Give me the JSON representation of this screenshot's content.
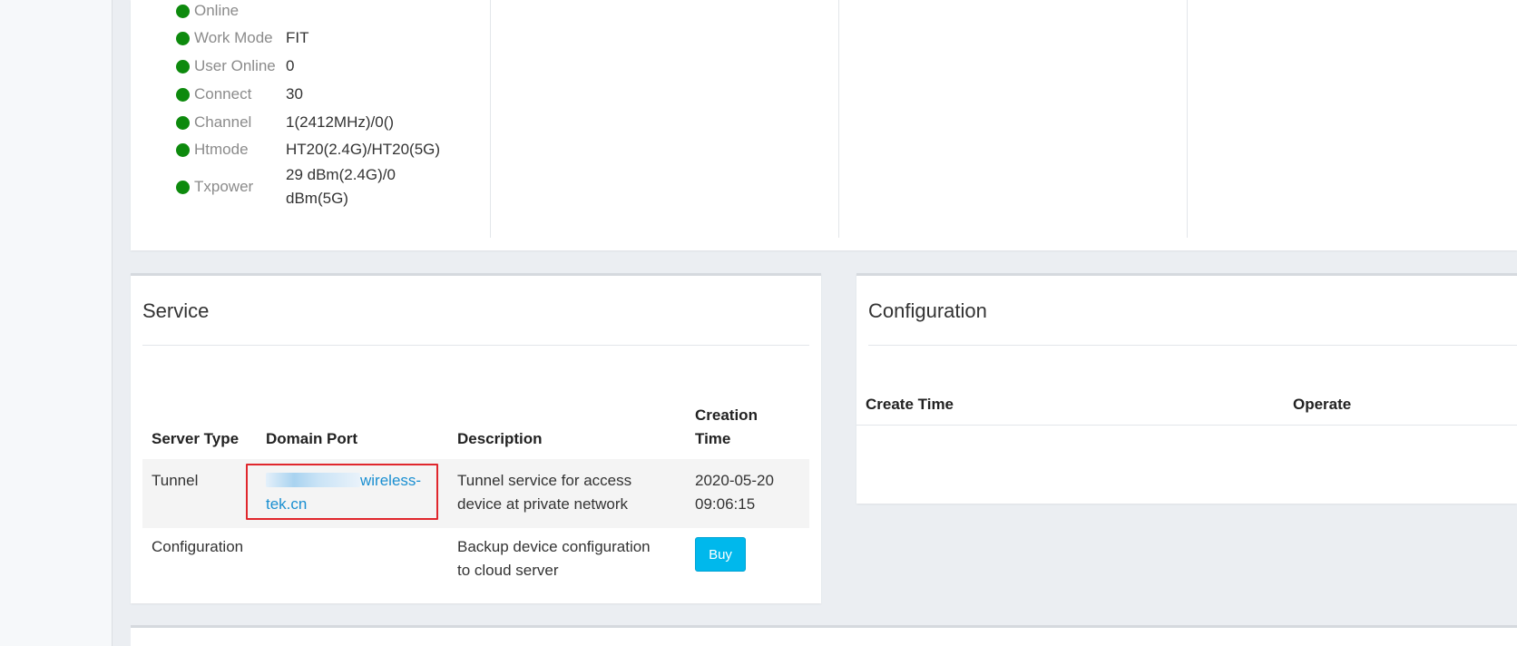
{
  "status": {
    "rows": [
      {
        "label": "Online",
        "value": ""
      },
      {
        "label": "Work Mode",
        "value": "FIT"
      },
      {
        "label": "User Online",
        "value": "0"
      },
      {
        "label": "Connect",
        "value": "30"
      },
      {
        "label": "Channel",
        "value": "1(2412MHz)/0()"
      },
      {
        "label": "Htmode",
        "value": "HT20(2.4G)/HT20(5G)"
      },
      {
        "label": "Txpower",
        "value_line1": "29 dBm(2.4G)/0",
        "value_line2": "dBm(5G)"
      }
    ],
    "dot_color": "#0d8a0d"
  },
  "service": {
    "title": "Service",
    "headers": {
      "server_type": "Server Type",
      "domain_port": "Domain Port",
      "description": "Description",
      "creation_time_line1": "Creation",
      "creation_time_line2": "Time"
    },
    "rows": [
      {
        "server_type": "Tunnel",
        "domain_line1_suffix": "wireless-",
        "domain_line2": "tek.cn",
        "description_line1": "Tunnel service for access",
        "description_line2": "device at private network",
        "creation_line1": "2020-05-20",
        "creation_line2": "09:06:15"
      },
      {
        "server_type": "Configuration",
        "description_line1": "Backup device configuration",
        "description_line2": "to cloud server",
        "action_label": "Buy"
      }
    ]
  },
  "configuration": {
    "title": "Configuration",
    "headers": {
      "create_time": "Create Time",
      "operate": "Operate"
    }
  },
  "colors": {
    "link": "#1a8fd1",
    "buy_button": "#00b8ec",
    "highlight": "#e0262c"
  }
}
